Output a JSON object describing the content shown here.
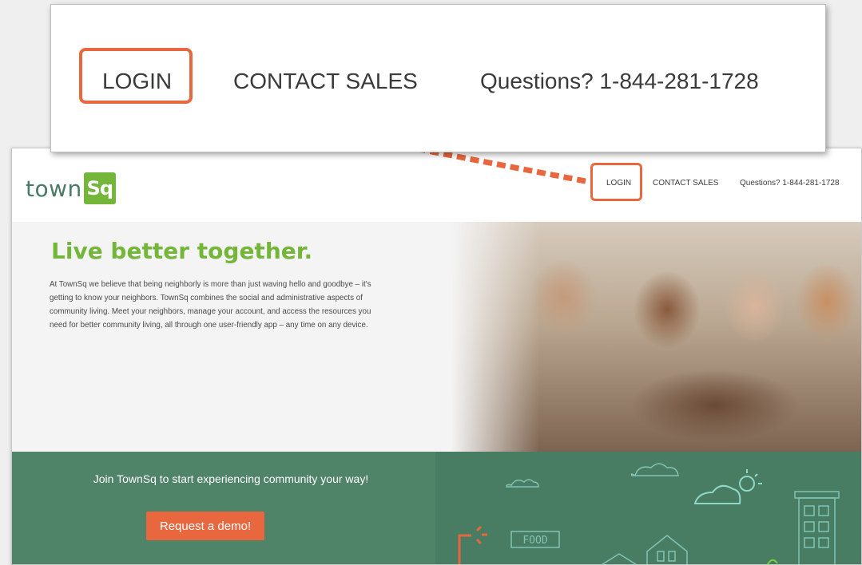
{
  "zoom": {
    "login": "LOGIN",
    "contact_sales": "CONTACT SALES",
    "phone": "Questions? 1-844-281-1728"
  },
  "header": {
    "logo_text": "town",
    "logo_badge": "Sq",
    "login": "LOGIN",
    "contact_sales": "CONTACT SALES",
    "phone": "Questions? 1-844-281-1728"
  },
  "hero": {
    "title": "Live better together.",
    "body": "At TownSq we believe that being neighborly is more than just waving hello and goodbye – it's getting to know your neighbors. TownSq combines the social and administrative aspects of community living. Meet your neighbors, manage your account, and access the resources you need for better community living, all through one user-friendly app – any time on any device."
  },
  "cta": {
    "text": "Join TownSq to start experiencing community your way!",
    "button": "Request a demo!"
  },
  "illustration": {
    "food_sign": "FOOD"
  },
  "colors": {
    "accent": "#e8673e",
    "brand_green": "#74b63a",
    "band_green": "#4f8469",
    "line_teal": "#8ed8c8"
  }
}
